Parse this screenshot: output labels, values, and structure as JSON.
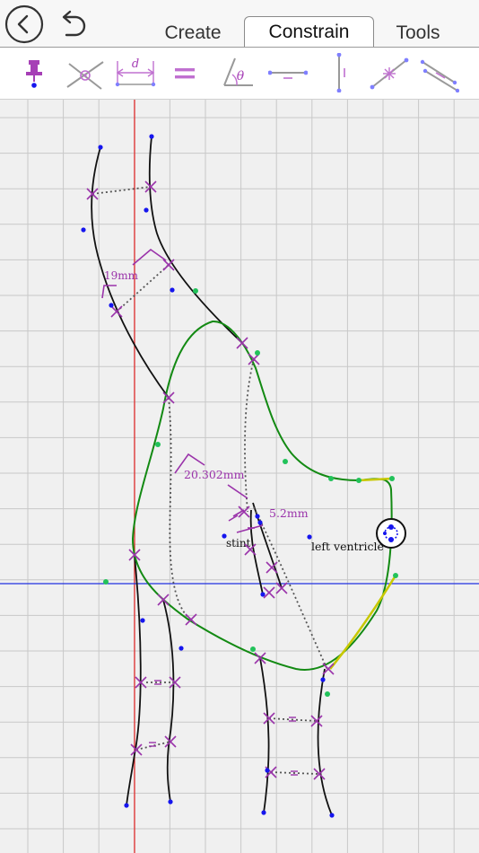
{
  "header": {
    "back_icon": "chevron-left-circle-icon",
    "undo_icon": "undo-arrow-icon",
    "tabs": [
      {
        "label": "Create",
        "active": false
      },
      {
        "label": "Constrain",
        "active": true
      },
      {
        "label": "Tools",
        "active": false
      }
    ]
  },
  "toolbar": {
    "tools": [
      {
        "name": "pin-fix-icon"
      },
      {
        "name": "coincident-icon"
      },
      {
        "name": "distance-icon",
        "glyph": "d"
      },
      {
        "name": "equal-icon"
      },
      {
        "name": "angle-icon",
        "glyph": "θ"
      },
      {
        "name": "horizontal-icon"
      },
      {
        "name": "vertical-icon"
      },
      {
        "name": "midpoint-icon"
      },
      {
        "name": "parallel-icon"
      }
    ],
    "accent": "#a63fb6"
  },
  "canvas": {
    "dimension_labels": [
      "19mm",
      "20.302mm",
      "5.2mm"
    ],
    "text_labels": [
      "stint",
      "left ventricle"
    ],
    "colors": {
      "grid": "#c8c8c8",
      "vertical_axis": "#e02020",
      "horizontal_axis": "#2030e0",
      "selected_curve": "#138a13",
      "highlight_curve": "#c8c800",
      "constraint": "#9a33aa",
      "points": "#1515ee",
      "control_points": "#22c25a"
    }
  }
}
